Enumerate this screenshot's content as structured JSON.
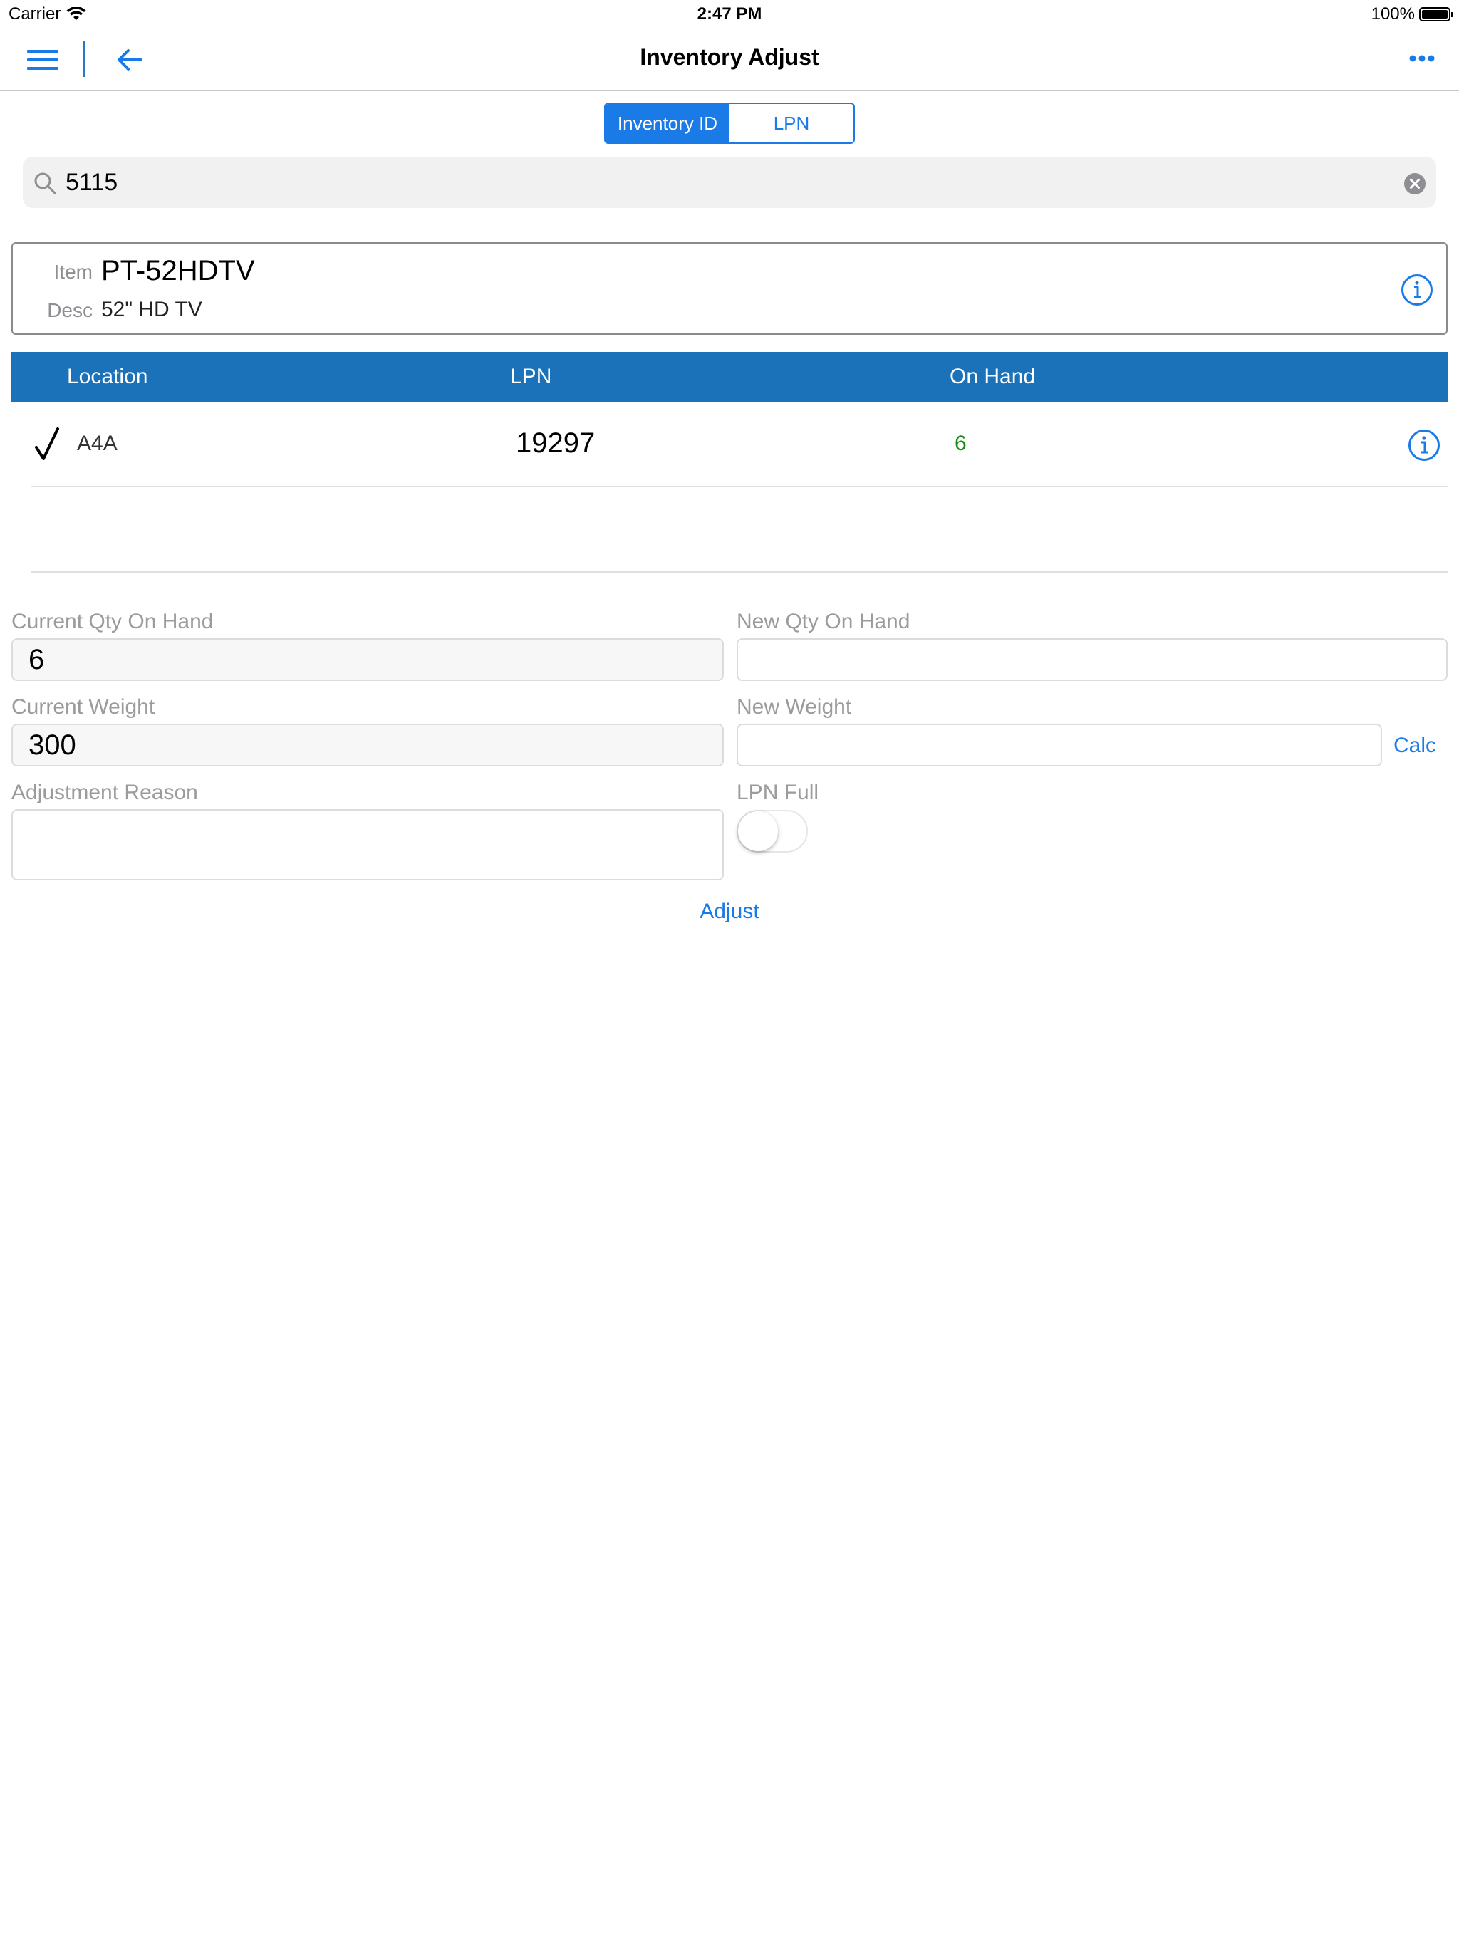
{
  "status_bar": {
    "carrier": "Carrier",
    "time": "2:47 PM",
    "battery": "100%"
  },
  "nav": {
    "title": "Inventory Adjust",
    "menu_icon": "hamburger-icon",
    "back_icon": "arrow-left-icon",
    "more_icon": "more-dots-icon"
  },
  "segmented": {
    "options": [
      "Inventory ID",
      "LPN"
    ],
    "selected": "Inventory ID"
  },
  "search": {
    "value": "5115",
    "icon": "search-icon",
    "clear_icon": "clear-circle-icon"
  },
  "item": {
    "item_label": "Item",
    "item_value": "PT-52HDTV",
    "desc_label": "Desc",
    "desc_value": "52\" HD TV"
  },
  "table": {
    "headers": [
      "Location",
      "LPN",
      "On Hand"
    ],
    "rows": [
      {
        "checked": true,
        "location": "A4A",
        "lpn": "19297",
        "on_hand": "6"
      }
    ]
  },
  "form": {
    "current_qty_label": "Current Qty On Hand",
    "current_qty_value": "6",
    "new_qty_label": "New Qty On Hand",
    "new_qty_value": "",
    "current_weight_label": "Current Weight",
    "current_weight_value": "300",
    "new_weight_label": "New Weight",
    "new_weight_value": "",
    "calc_label": "Calc",
    "reason_label": "Adjustment Reason",
    "reason_value": "",
    "lpn_full_label": "LPN Full",
    "lpn_full_on": false,
    "adjust_label": "Adjust"
  },
  "colors": {
    "accent": "#1a7ae6",
    "table_header": "#1b72b8",
    "on_hand_text": "#1a8a1a",
    "label_gray": "#9b9b9b"
  }
}
